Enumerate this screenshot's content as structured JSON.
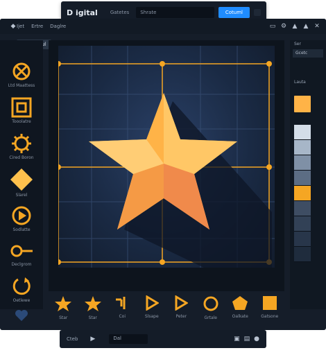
{
  "app": {
    "title": "D igital",
    "tab1": "Gatetes",
    "tab2": "Shrate",
    "action": "Cotuml"
  },
  "menu": {
    "items": [
      "Ijet",
      "Ertre",
      "Daglre"
    ]
  },
  "toolbar": {
    "tab": "Gamteoul"
  },
  "left_tools": [
    {
      "icon": "ellipse-tool-icon",
      "label": "Ltd Maattess"
    },
    {
      "icon": "frame-tool-icon",
      "label": "Tooolatre"
    },
    {
      "icon": "gear-tool-icon",
      "label": "Cired Boron"
    },
    {
      "icon": "diamond-tool-icon",
      "label": "Slarel"
    },
    {
      "icon": "play-tool-icon",
      "label": "Sodlatte"
    },
    {
      "icon": "connector-tool-icon",
      "label": "Declgrom"
    },
    {
      "icon": "rotate-tool-icon",
      "label": "Oetlewe"
    }
  ],
  "shapes": [
    {
      "icon": "star-shape-icon",
      "label": "Star"
    },
    {
      "icon": "star-outline-shape-icon",
      "label": "Star"
    },
    {
      "icon": "corner-shape-icon",
      "label": "Coi"
    },
    {
      "icon": "triangle-shape-icon",
      "label": "Slsape"
    },
    {
      "icon": "play-shape-icon",
      "label": "Peter"
    },
    {
      "icon": "circle-shape-icon",
      "label": "Grtale"
    },
    {
      "icon": "pentagon-shape-icon",
      "label": "Oalkate"
    },
    {
      "icon": "square-shape-icon",
      "label": "Gatsone"
    }
  ],
  "right_panel": {
    "header": "Ser",
    "select": "Gcetc",
    "section": "Lauta"
  },
  "status": {
    "label": "Cteb",
    "field": "Dal"
  },
  "colors": {
    "accent": "#1f8cff",
    "star": "#ffb347",
    "handle": "#f5a623"
  }
}
